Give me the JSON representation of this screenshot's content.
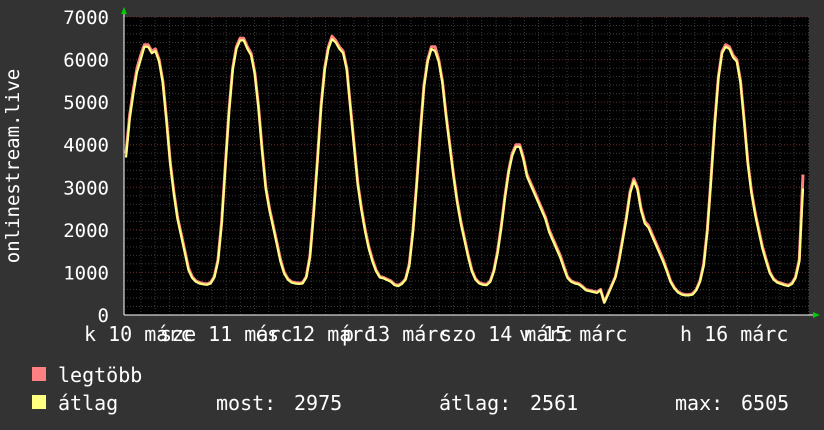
{
  "chart_data": {
    "type": "line",
    "ylabel": "onlinestream.live",
    "ylim": [
      0,
      7000
    ],
    "y_ticks": [
      0,
      1000,
      2000,
      3000,
      4000,
      5000,
      6000,
      7000
    ],
    "x_tick_labels": [
      "k 10 márc",
      "sze 11 márc",
      "cs 12 márc",
      "p 13 márc",
      "szo 14 márc",
      "v 15 márc",
      "h 16 márc"
    ],
    "grid": true,
    "background": "#000000",
    "canvas_bg": "#333333",
    "colors": {
      "max": "#ff8080",
      "avg": "#ffff80",
      "grid": "#555555",
      "axis": "#ffffff",
      "arrow": "#00cc00"
    },
    "series": [
      {
        "name": "legtöbb",
        "color": "#ff8080",
        "values": [
          3800,
          4700,
          5300,
          5800,
          6100,
          6350,
          6350,
          6200,
          6250,
          6000,
          5500,
          4600,
          3600,
          2900,
          2300,
          1900,
          1500,
          1100,
          900,
          800,
          760,
          740,
          730,
          760,
          900,
          1300,
          2200,
          3500,
          4800,
          5800,
          6300,
          6505,
          6500,
          6300,
          6150,
          5700,
          4900,
          3900,
          3000,
          2500,
          2100,
          1700,
          1300,
          1000,
          850,
          780,
          760,
          750,
          760,
          900,
          1400,
          2400,
          3600,
          4900,
          5800,
          6300,
          6550,
          6450,
          6300,
          6200,
          5800,
          4900,
          4000,
          3100,
          2500,
          2000,
          1600,
          1300,
          1050,
          900,
          880,
          840,
          800,
          720,
          700,
          750,
          850,
          1200,
          2000,
          3100,
          4300,
          5400,
          6000,
          6300,
          6300,
          6000,
          5500,
          4700,
          4000,
          3300,
          2700,
          2200,
          1800,
          1400,
          1050,
          850,
          760,
          730,
          720,
          800,
          1050,
          1500,
          2100,
          2800,
          3400,
          3800,
          4000,
          4000,
          3700,
          3300,
          3100,
          2900,
          2700,
          2500,
          2300,
          2000,
          1800,
          1600,
          1400,
          1150,
          900,
          800,
          760,
          740,
          680,
          600,
          580,
          560,
          540,
          600,
          300,
          500,
          700,
          900,
          1300,
          1800,
          2300,
          2900,
          3200,
          3000,
          2500,
          2200,
          2100,
          1900,
          1700,
          1500,
          1300,
          1050,
          800,
          650,
          550,
          500,
          480,
          480,
          500,
          600,
          800,
          1200,
          2000,
          3200,
          4500,
          5600,
          6200,
          6350,
          6300,
          6100,
          6000,
          5500,
          4600,
          3600,
          2900,
          2400,
          2000,
          1600,
          1300,
          1000,
          850,
          780,
          750,
          720,
          700,
          750,
          900,
          1300,
          3300
        ]
      },
      {
        "name": "átlag",
        "color": "#ffff80",
        "values": [
          3700,
          4600,
          5200,
          5700,
          6000,
          6300,
          6300,
          6150,
          6200,
          5950,
          5450,
          4550,
          3550,
          2850,
          2250,
          1850,
          1450,
          1050,
          870,
          780,
          740,
          720,
          710,
          740,
          880,
          1250,
          2150,
          3450,
          4750,
          5750,
          6250,
          6450,
          6450,
          6250,
          6100,
          5650,
          4850,
          3850,
          2950,
          2450,
          2050,
          1650,
          1250,
          970,
          830,
          760,
          740,
          730,
          740,
          880,
          1350,
          2350,
          3550,
          4850,
          5750,
          6250,
          6480,
          6400,
          6250,
          6150,
          5750,
          4850,
          3950,
          3050,
          2450,
          1950,
          1550,
          1250,
          1020,
          880,
          860,
          820,
          780,
          700,
          680,
          730,
          830,
          1150,
          1950,
          3050,
          4250,
          5350,
          5950,
          6250,
          6200,
          5950,
          5450,
          4650,
          3950,
          3250,
          2650,
          2150,
          1750,
          1350,
          1020,
          830,
          740,
          710,
          700,
          780,
          1020,
          1450,
          2050,
          2750,
          3350,
          3750,
          3950,
          3950,
          3650,
          3250,
          3050,
          2850,
          2650,
          2450,
          2250,
          1950,
          1750,
          1550,
          1350,
          1100,
          870,
          780,
          740,
          720,
          660,
          580,
          560,
          540,
          520,
          580,
          290,
          480,
          680,
          880,
          1250,
          1750,
          2250,
          2850,
          3150,
          2950,
          2450,
          2150,
          2050,
          1850,
          1650,
          1450,
          1250,
          1020,
          780,
          630,
          530,
          480,
          460,
          460,
          480,
          580,
          780,
          1150,
          1950,
          3150,
          4450,
          5550,
          6150,
          6300,
          6250,
          6050,
          5950,
          5450,
          4550,
          3550,
          2850,
          2350,
          1950,
          1550,
          1250,
          980,
          830,
          760,
          730,
          700,
          680,
          730,
          870,
          1250,
          2975
        ]
      }
    ]
  },
  "legend": {
    "items": [
      {
        "label": "legtöbb",
        "color": "#ff8080"
      },
      {
        "label": "átlag",
        "color": "#ffff80"
      }
    ],
    "stats": {
      "now_label": "most:",
      "now_value": "2975",
      "avg_label": "átlag:",
      "avg_value": "2561",
      "max_label": "max:",
      "max_value": "6505"
    }
  }
}
